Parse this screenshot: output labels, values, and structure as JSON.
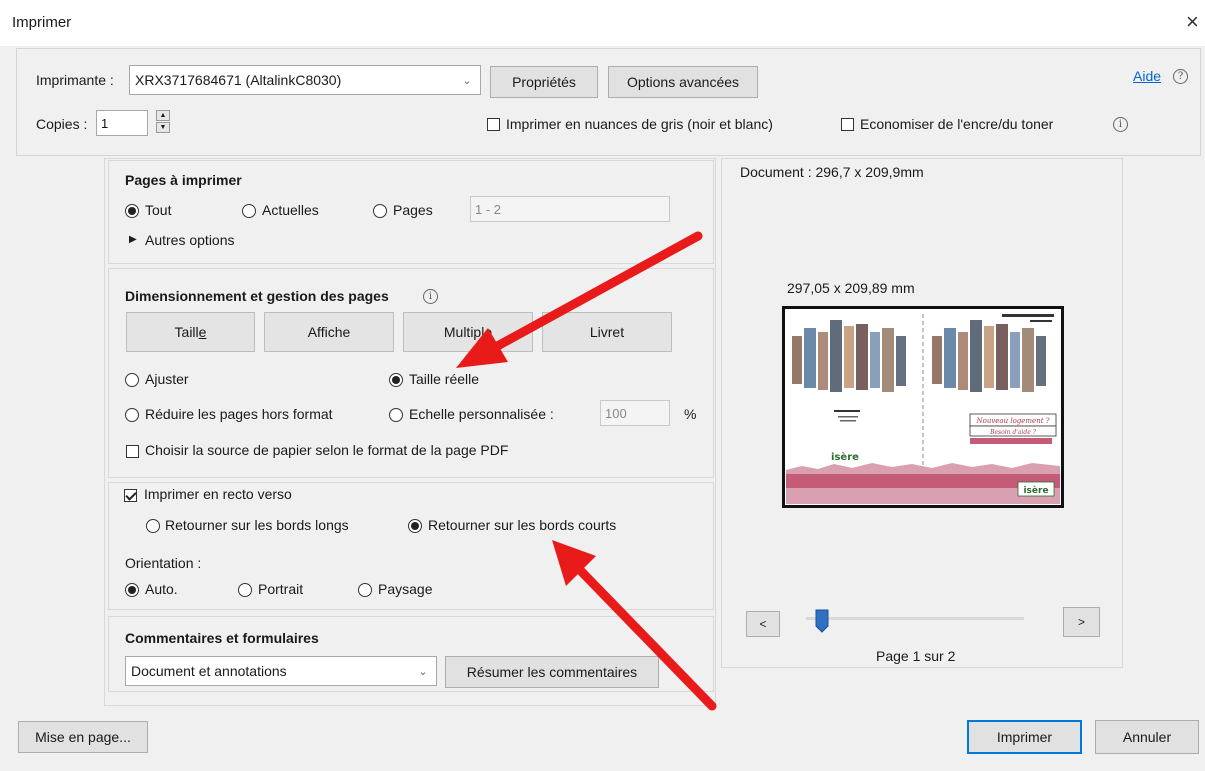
{
  "window": {
    "title": "Imprimer",
    "close_glyph": "×"
  },
  "top": {
    "printer_label": "Imprimante :",
    "printer_value": "XRX3717684671 (AltalinkC8030)",
    "properties_label": "Propriétés",
    "advanced_label": "Options avancées",
    "help_label": "Aide",
    "help_icon_glyph": "?",
    "copies_label": "Copies :",
    "copies_value": "1",
    "grayscale_label": "Imprimer en nuances de gris (noir et blanc)",
    "grayscale_checked": false,
    "save_ink_label": "Economiser de l'encre/du toner",
    "save_ink_checked": false,
    "info_glyph": "i"
  },
  "pages_section": {
    "title": "Pages à imprimer",
    "options": [
      "Tout",
      "Actuelles",
      "Pages"
    ],
    "selected": "Tout",
    "range_placeholder": "1 - 2",
    "more_options": "Autres options"
  },
  "sizing_section": {
    "title": "Dimensionnement et gestion des pages",
    "mode_buttons": [
      "Taille",
      "Affiche",
      "Multiple",
      "Livret"
    ],
    "fit_label": "Ajuster",
    "actual_size_label": "Taille réelle",
    "shrink_label": "Réduire les pages hors format",
    "custom_scale_label": "Echelle personnalisée :",
    "scale_value": "100",
    "percent_sign": "%",
    "selected": "Taille réelle",
    "paper_source_label": "Choisir la source de papier selon le format de la page PDF",
    "paper_source_checked": false
  },
  "duplex_section": {
    "duplex_label": "Imprimer en recto verso",
    "duplex_checked": true,
    "long_edge_label": "Retourner sur les bords longs",
    "short_edge_label": "Retourner sur les bords courts",
    "flip_selected": "Retourner sur les bords courts",
    "orientation_label": "Orientation :",
    "orientation_options": [
      "Auto.",
      "Portrait",
      "Paysage"
    ],
    "orientation_selected": "Auto."
  },
  "comments_section": {
    "title": "Commentaires et formulaires",
    "select_value": "Document et annotations",
    "summarize_label": "Résumer les commentaires"
  },
  "preview": {
    "document_label": "Document : 296,7 x 209,9mm",
    "sheet_size_label": "297,05 x 209,89 mm",
    "prev_label": "<",
    "next_label": ">",
    "page_status": "Page 1 sur 2",
    "page_position": 0.0,
    "right_title_1": "Nouveau logement ?",
    "right_title_2": "Besoin d'aide ?",
    "brand": "isère"
  },
  "bottom": {
    "page_setup_label": "Mise en page...",
    "print_label": "Imprimer",
    "cancel_label": "Annuler"
  },
  "colors": {
    "accent": "#0078d7",
    "annotation_arrow": "#e81a1a",
    "slider_thumb": "#2f6fc4",
    "brochure_band": "#c45c78",
    "brochure_brand": "#2f6b2f"
  }
}
